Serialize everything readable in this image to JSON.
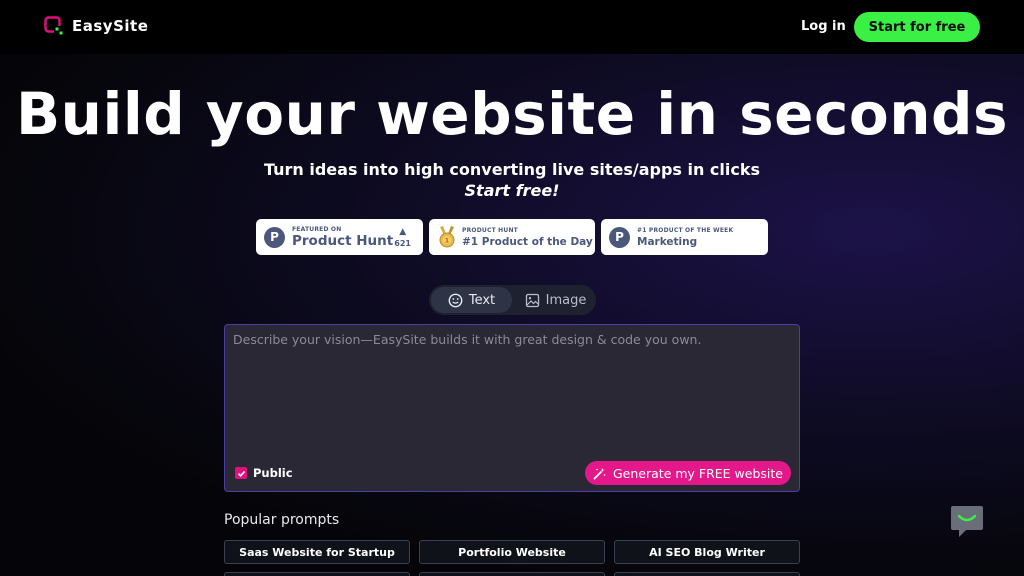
{
  "nav": {
    "logo_text": "EasySite",
    "login_label": "Log in",
    "start_label": "Start for free"
  },
  "hero": {
    "title": "Build your website in seconds",
    "subtitle": "Turn ideas into high converting live sites/apps in clicks",
    "subtitle2": "Start free!"
  },
  "badges": {
    "featured": {
      "small": "FEATURED ON",
      "big": "Product Hunt",
      "upvotes": "621"
    },
    "day": {
      "small": "PRODUCT HUNT",
      "big": "#1 Product of the Day"
    },
    "week": {
      "small": "#1 PRODUCT OF THE WEEK",
      "big": "Marketing"
    }
  },
  "mode": {
    "text_label": "Text",
    "image_label": "Image",
    "selected": "Text"
  },
  "prompt": {
    "placeholder": "Describe your vision—EasySite builds it with great design & code you own.",
    "value": "",
    "public_label": "Public",
    "public_checked": true,
    "generate_label": "Generate my FREE website"
  },
  "popular": {
    "title": "Popular prompts",
    "items": [
      "Saas Website for Startup",
      "Portfolio Website",
      "AI SEO Blog Writer"
    ]
  },
  "colors": {
    "accent_green": "#3bf045",
    "accent_pink": "#e4188a",
    "logo_pink": "#e0107e",
    "logo_green": "#3bf045",
    "badge_text": "#4b587c"
  },
  "icons": {
    "logo": "easysite-logo-icon",
    "text_mode": "smile-icon",
    "image_mode": "image-icon",
    "generate": "magic-wand-icon",
    "upvote": "triangle-up-icon",
    "medal": "medal-icon",
    "chat": "chat-icon"
  }
}
